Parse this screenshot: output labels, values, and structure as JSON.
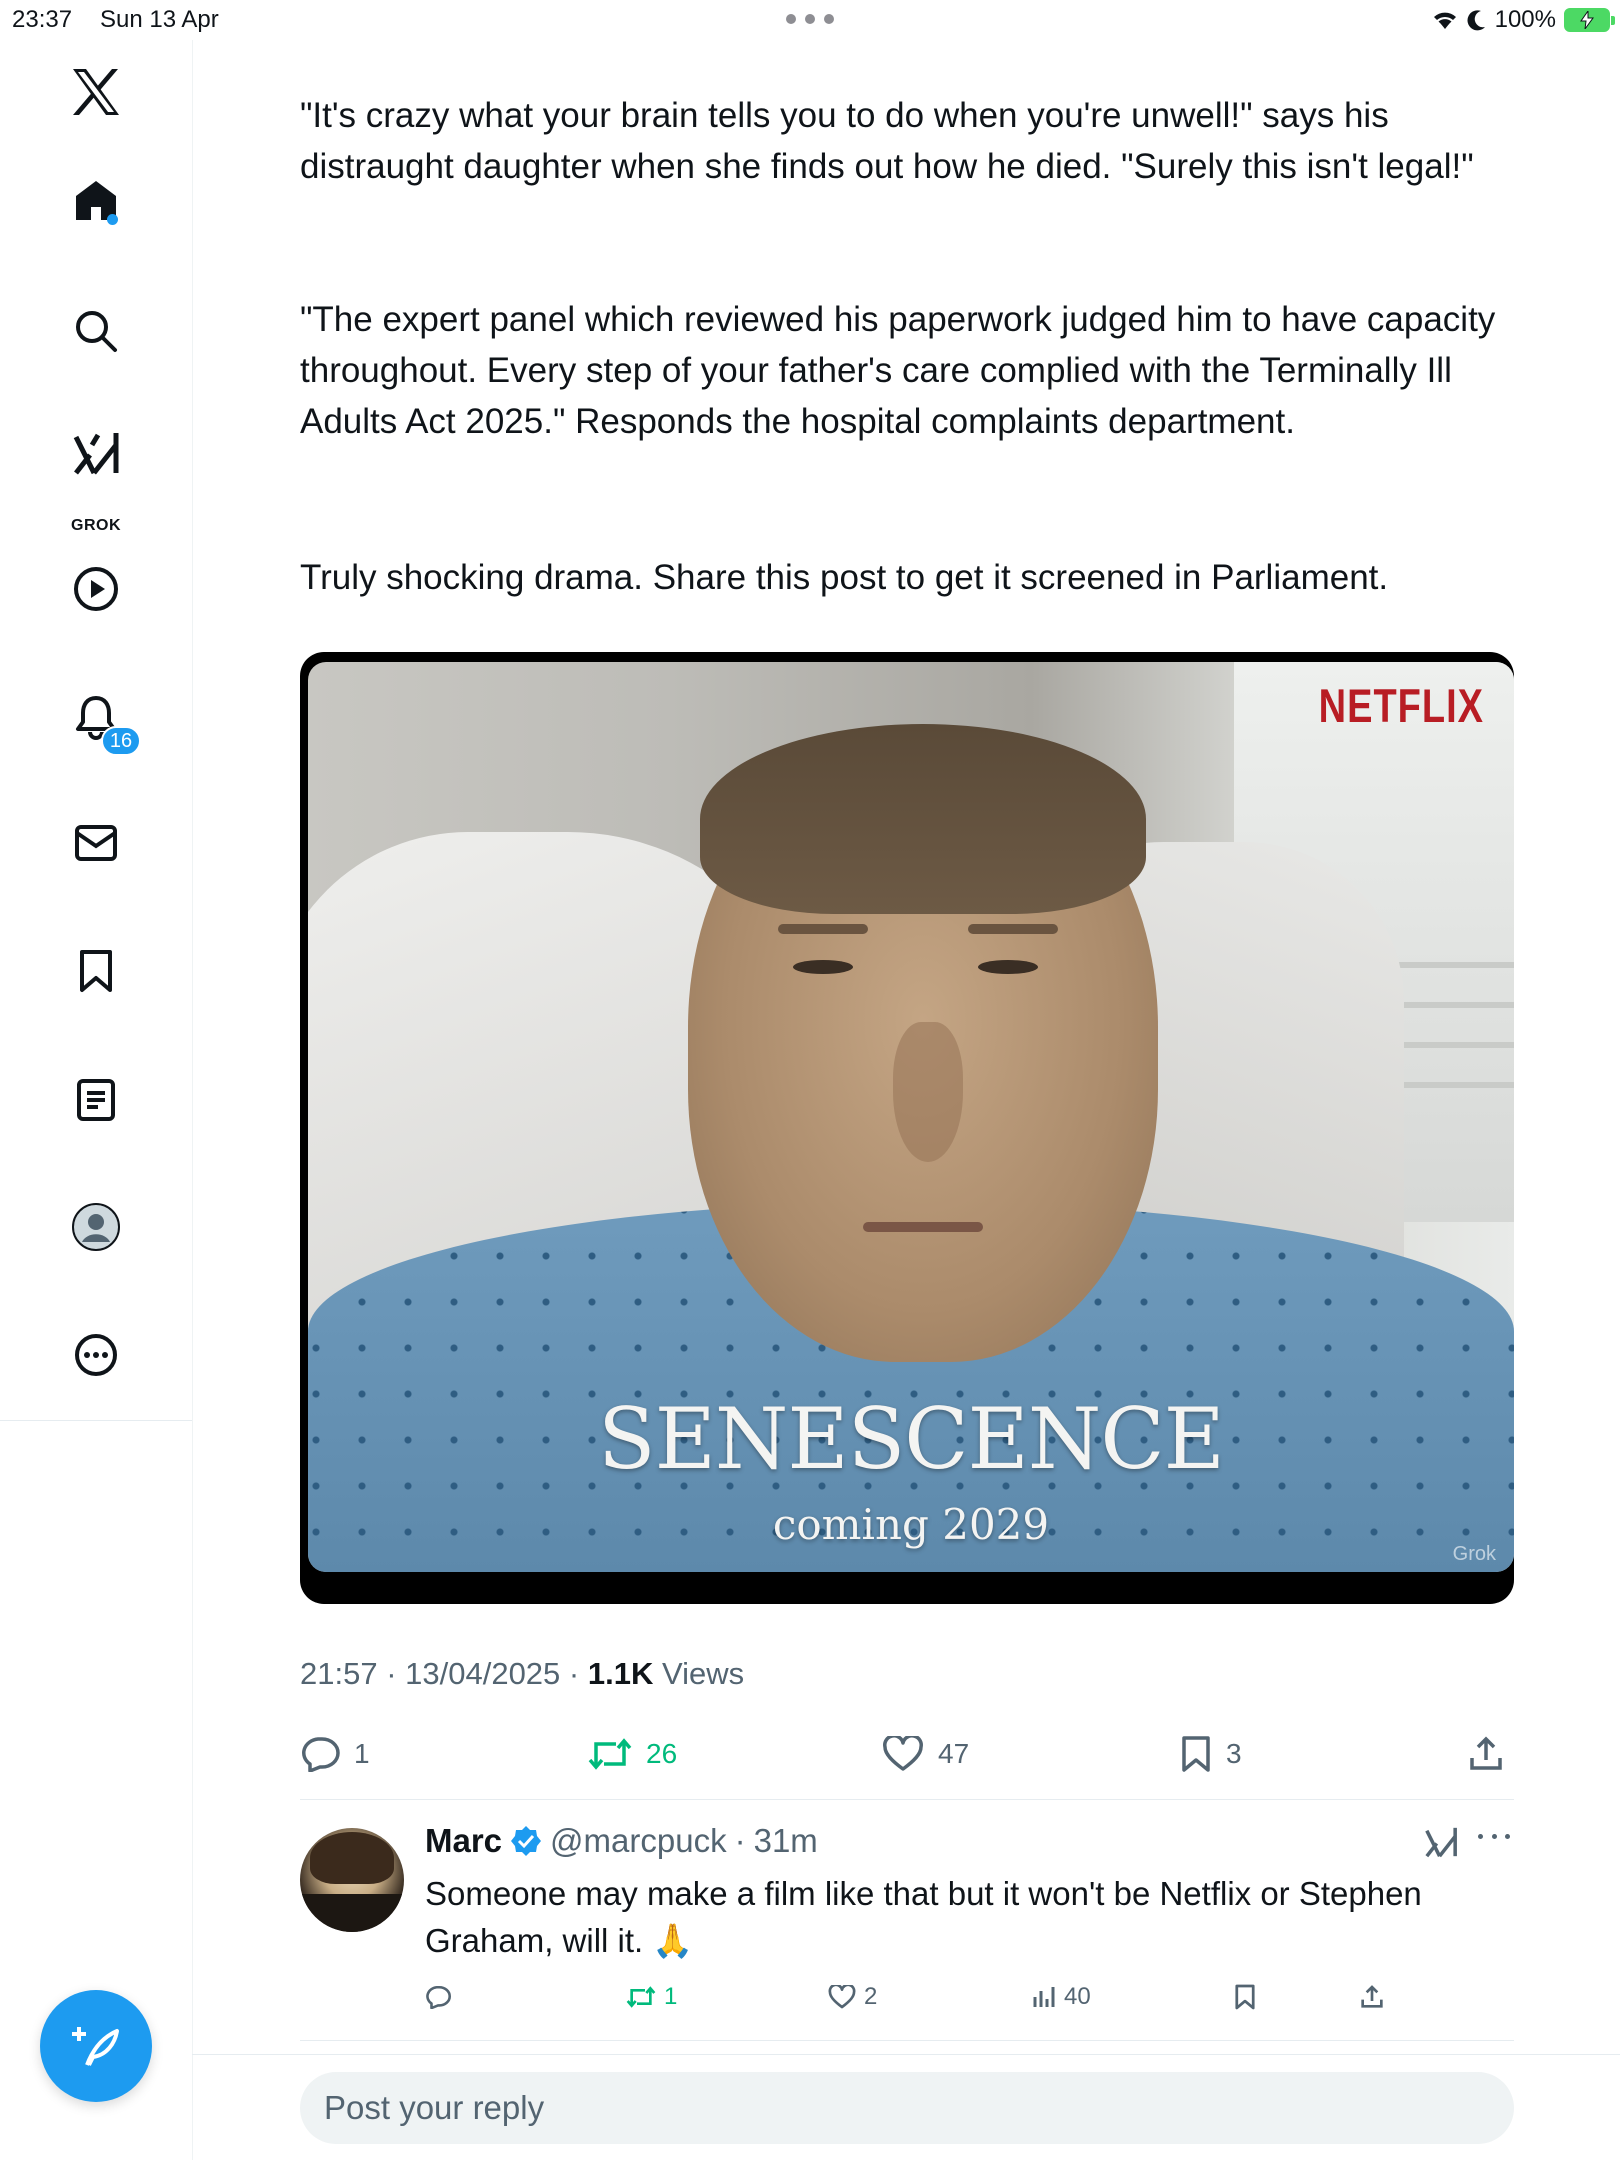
{
  "status_bar": {
    "time": "23:37",
    "date": "Sun 13 Apr",
    "battery": "100%"
  },
  "sidebar": {
    "grok_label": "GROK",
    "notifications_count": "16",
    "items": [
      "x-logo",
      "home-icon",
      "search-icon",
      "grok-icon",
      "video-icon",
      "bell-icon",
      "mail-icon",
      "bookmark-icon",
      "list-icon",
      "profile-icon",
      "more-icon"
    ]
  },
  "post": {
    "paragraph_1": "\"It's crazy what your brain tells you to do when you're unwell!\" says his distraught daughter when she finds out how he died. \"Surely this isn't legal!\"",
    "paragraph_2": "\"The expert panel which reviewed his paperwork judged him to have capacity throughout. Every step of your father's care complied with the Terminally Ill Adults Act 2025.\" Responds the hospital complaints department.",
    "paragraph_3": "Truly shocking drama. Share this post to get it screened in Parliament.",
    "media": {
      "netflix_logo": "NETFLIX",
      "title": "SENESCENCE",
      "subtitle": "coming 2029",
      "watermark": "Grok"
    },
    "time": "21:57",
    "date": "13/04/2025",
    "views_count": "1.1K",
    "views_label": "Views",
    "replies": "1",
    "reposts": "26",
    "likes": "47",
    "bookmarks": "3"
  },
  "reply": {
    "name": "Marc",
    "handle": "@marcpuck",
    "age": "31m",
    "text": "Someone may make a film like that but it won't be Netflix or Stephen Graham, will it. 🙏",
    "reposts": "1",
    "likes": "2",
    "views": "40"
  },
  "composer": {
    "placeholder": "Post your reply"
  },
  "colors": {
    "accent": "#1d9bf0",
    "repost_green": "#00ba7c",
    "secondary_text": "#536471"
  }
}
